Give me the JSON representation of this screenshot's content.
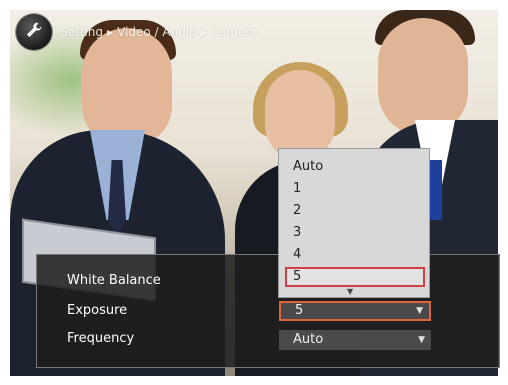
{
  "header": {
    "breadcrumb": [
      "Setting",
      "Video / Audio",
      "Camera"
    ],
    "icon": "wrench-icon"
  },
  "settings": {
    "white_balance_label": "White Balance",
    "exposure_label": "Exposure",
    "exposure_value": "5",
    "frequency_label": "Frequency",
    "frequency_value": "Auto"
  },
  "exposure_dropdown": {
    "options": [
      "Auto",
      "1",
      "2",
      "3",
      "4",
      "5"
    ],
    "selected": "5"
  },
  "colors": {
    "focus_border": "#e0633a",
    "selected_option_border": "#d04040"
  }
}
